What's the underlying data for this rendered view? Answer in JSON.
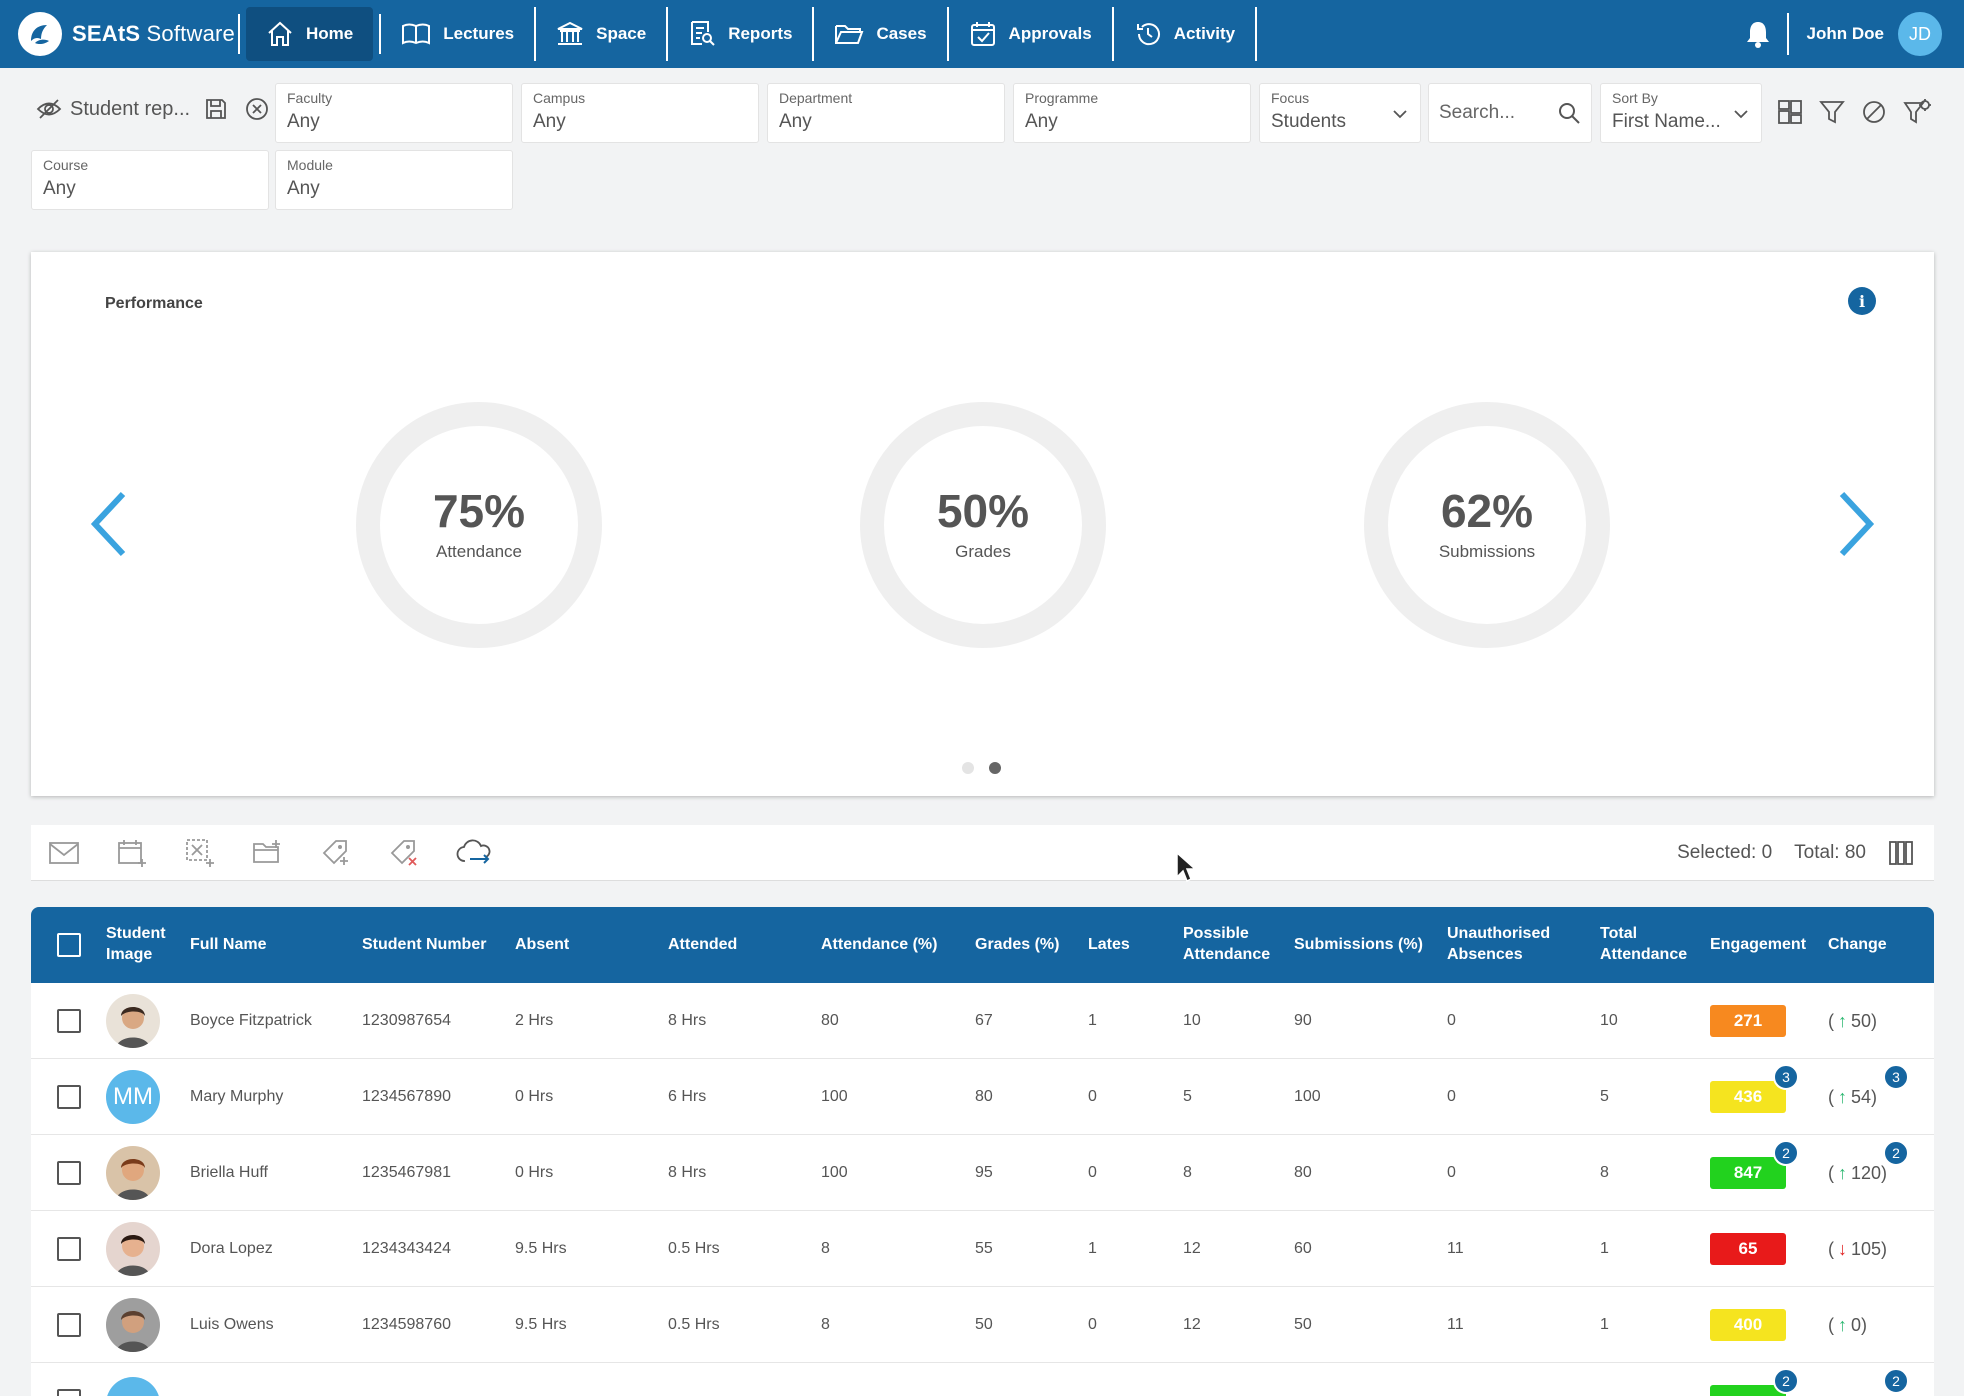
{
  "nav": {
    "brand_bold": "SEAtS",
    "brand_rest": " Software",
    "items": [
      {
        "label": "Home"
      },
      {
        "label": "Lectures"
      },
      {
        "label": "Space"
      },
      {
        "label": "Reports"
      },
      {
        "label": "Cases"
      },
      {
        "label": "Approvals"
      },
      {
        "label": "Activity"
      }
    ],
    "user_name": "John Doe",
    "user_initials": "JD"
  },
  "filters": {
    "report_name": "Student rep...",
    "faculty": {
      "label": "Faculty",
      "value": "Any"
    },
    "campus": {
      "label": "Campus",
      "value": "Any"
    },
    "department": {
      "label": "Department",
      "value": "Any"
    },
    "programme": {
      "label": "Programme",
      "value": "Any"
    },
    "focus": {
      "label": "Focus",
      "value": "Students"
    },
    "search_placeholder": "Search...",
    "sort_by": {
      "label": "Sort By",
      "value": "First Name..."
    },
    "course": {
      "label": "Course",
      "value": "Any"
    },
    "module": {
      "label": "Module",
      "value": "Any"
    }
  },
  "performance": {
    "title": "Performance",
    "info_glyph": "i",
    "gauges": [
      {
        "pct": "75%",
        "caption": "Attendance"
      },
      {
        "pct": "50%",
        "caption": "Grades"
      },
      {
        "pct": "62%",
        "caption": "Submissions"
      }
    ]
  },
  "actions": {
    "selected": "Selected: 0",
    "total": "Total: 80"
  },
  "table": {
    "headers": {
      "image_1": "Student",
      "image_2": "Image",
      "full_name": "Full Name",
      "student_number": "Student Number",
      "absent": "Absent",
      "attended": "Attended",
      "attendance_pct": "Attendance (%)",
      "grades_pct": "Grades (%)",
      "lates": "Lates",
      "possible_1": "Possible",
      "possible_2": "Attendance",
      "submissions_pct": "Submissions (%)",
      "unauth_1": "Unauthorised",
      "unauth_2": "Absences",
      "total_1": "Total",
      "total_2": "Attendance",
      "engagement": "Engagement",
      "change": "Change"
    },
    "rows": [
      {
        "name": "Boyce Fitzpatrick",
        "number": "1230987654",
        "absent": "2 Hrs",
        "attended": "8 Hrs",
        "attendance": "80",
        "grades": "67",
        "lates": "1",
        "possible": "10",
        "submissions": "90",
        "unauth": "0",
        "total": "10",
        "engagement": "271",
        "eng_color": "#f7891f",
        "change_open": "(",
        "change_val": "50)",
        "change_dir": "↑"
      },
      {
        "name": "Mary Murphy",
        "initials": "MM",
        "number": "1234567890",
        "absent": "0 Hrs",
        "attended": "6 Hrs",
        "attendance": "100",
        "grades": "80",
        "lates": "0",
        "possible": "5",
        "submissions": "100",
        "unauth": "0",
        "total": "5",
        "engagement": "436",
        "eng_color": "#f5e41f",
        "eng_badge": "3",
        "change_open": "(",
        "change_val": "54)",
        "change_dir": "↑",
        "change_badge": "3"
      },
      {
        "name": "Briella Huff",
        "number": "1235467981",
        "absent": "0 Hrs",
        "attended": "8 Hrs",
        "attendance": "100",
        "grades": "95",
        "lates": "0",
        "possible": "8",
        "submissions": "80",
        "unauth": "0",
        "total": "8",
        "engagement": "847",
        "eng_color": "#22d21e",
        "eng_badge": "2",
        "change_open": "(",
        "change_val": "120)",
        "change_dir": "↑",
        "change_badge": "2"
      },
      {
        "name": "Dora Lopez",
        "number": "1234343424",
        "absent": "9.5 Hrs",
        "attended": "0.5 Hrs",
        "attendance": "8",
        "grades": "55",
        "lates": "1",
        "possible": "12",
        "submissions": "60",
        "unauth": "11",
        "total": "1",
        "engagement": "65",
        "eng_color": "#e81a1a",
        "change_open": "(",
        "change_val": "105)",
        "change_dir": "↓"
      },
      {
        "name": "Luis Owens",
        "number": "1234598760",
        "absent": "9.5 Hrs",
        "attended": "0.5 Hrs",
        "attendance": "8",
        "grades": "50",
        "lates": "0",
        "possible": "12",
        "submissions": "50",
        "unauth": "11",
        "total": "1",
        "engagement": "400",
        "eng_color": "#f5e41f",
        "change_open": "(",
        "change_val": "0)",
        "change_dir": "↑"
      }
    ],
    "partial_row": {
      "eng_badge": "2",
      "change_badge": "2",
      "eng_color": "#22d21e"
    }
  }
}
